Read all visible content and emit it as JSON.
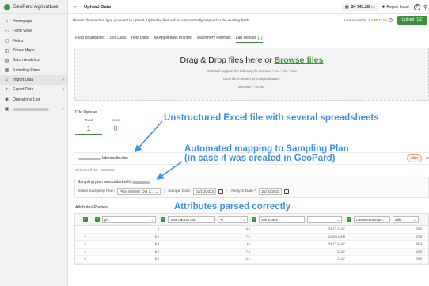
{
  "sidebar": {
    "brand": "GeoPard Agriculture",
    "items": [
      {
        "label": "Homepage",
        "icon": "home-icon",
        "active": false,
        "arrow": ""
      },
      {
        "label": "Farm View",
        "icon": "farm-icon",
        "active": false,
        "arrow": ""
      },
      {
        "label": "Fields",
        "icon": "field-icon",
        "active": false,
        "arrow": ""
      },
      {
        "label": "Zones Maps",
        "icon": "zones-icon",
        "active": false,
        "arrow": ""
      },
      {
        "label": "Batch Analytics",
        "icon": "batch-icon",
        "active": false,
        "arrow": ""
      },
      {
        "label": "Sampling Plans",
        "icon": "sampling-icon",
        "active": false,
        "arrow": ""
      },
      {
        "label": "Import Data",
        "icon": "import-icon",
        "active": true,
        "arrow": ">"
      },
      {
        "label": "Export Data",
        "icon": "export-icon",
        "active": false,
        "arrow": ">"
      },
      {
        "label": "Operations Log",
        "icon": "log-icon",
        "active": false,
        "arrow": ""
      }
    ],
    "account_arrow": ">"
  },
  "header": {
    "back": "←",
    "title": "Upload Data",
    "area_value": "34 741.28",
    "area_unit": "ha",
    "report_label": "Report Issue",
    "help": "?"
  },
  "subbar": {
    "description": "Please choose data type you want to upload. Uploaded files will be automatically mapped to the existing fields.",
    "available_label": "Area available:",
    "available_value": "$ 258.73 ha",
    "upload_button": "Upload (1/1)"
  },
  "tabs": [
    "Field Boundaries",
    "Soil Data",
    "Yield Data",
    "As Applied/As Planted",
    "Machinery Formats",
    "Lab Results (1)"
  ],
  "dropzone": {
    "title_prefix": "Drag & Drop files here or ",
    "browse": "Browse files",
    "line1": "GeoPard supports the following file formats: *.csv, *.xls, *.xlsx",
    "line2": "Each file is treated as a single dataset.",
    "line3": "Max size – 45 MB."
  },
  "file_upload": {
    "title": "File Upload",
    "total_label": "Total",
    "total_value": "1",
    "error_label": "Error",
    "error_value": "0"
  },
  "file_row": {
    "name": "lab results.xlsx",
    "chip": "xlsx",
    "close": "×"
  },
  "selected_field_label": "Selected field:",
  "sampling_plan": {
    "title": "Sampling plan associated with",
    "select_label": "Select Sampling Plan:",
    "plan_prefix": "Plan",
    "plan_suffix": "Oct 2...",
    "sample_date_label": "Sample Date:",
    "sample_date": "01/10/2023",
    "analyze_date_label": "Analyze Date *:",
    "analyze_date": "25/10/2023"
  },
  "attributes": {
    "title": "Attributes Preview",
    "headers": [
      {
        "value": "pH"
      },
      {
        "value": "Total calcium car...",
        "unit": "%"
      },
      {
        "value": "Soil texture",
        "unit": ""
      },
      {
        "value": "Cation exchange...",
        "unit": "milli..."
      }
    ],
    "rows": [
      {
        "n": "1",
        "a": "8",
        "b": "14.6",
        "c": "SILTY CLAY",
        "d": "29.2"
      },
      {
        "n": "2",
        "a": "8.2",
        "b": "7.2",
        "c": "CLAY LOAM",
        "d": "27.8"
      },
      {
        "n": "3",
        "a": "8.4",
        "b": "12",
        "c": "SILTY CLAY",
        "d": "31.4"
      },
      {
        "n": "4",
        "a": "8.2",
        "b": "7.9",
        "c": "CLAY",
        "d": "32.9"
      },
      {
        "n": "5",
        "a": "8.3",
        "b": "12.1",
        "c": "CLAY",
        "d": "29.9"
      }
    ]
  },
  "annotations": {
    "a1": "Unstructured Excel file with several spreadsheets",
    "a2_line1": "Automated mapping to Sampling Plan",
    "a2_line2": "(in case it was created in GeoPard)",
    "a3": "Attributes parsed correctly"
  },
  "colors": {
    "accent": "#3c8f3c",
    "annotation": "#3f8ee6",
    "warning": "#c05e34"
  }
}
